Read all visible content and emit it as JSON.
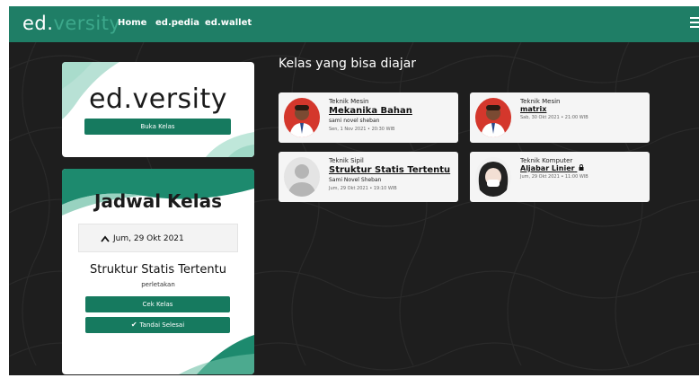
{
  "navbar": {
    "logo_part1": "ed.",
    "logo_part2": "versity",
    "links": [
      "Home",
      "ed.pedia",
      "ed.wallet"
    ],
    "menu_icon": "hamburger-icon"
  },
  "brand_card": {
    "title": "ed.versity",
    "button": "Buka Kelas"
  },
  "schedule_card": {
    "title": "Jadwal Kelas",
    "date": "Jum, 29 Okt 2021",
    "chevron_icon": "chevron-up-icon",
    "class_title": "Struktur Statis Tertentu",
    "class_sub": "perletakan",
    "check_button": "Cek Kelas",
    "done_button": "Tandai Selesai",
    "done_icon": "check-icon"
  },
  "section_title": "Kelas yang bisa diajar",
  "classes": [
    {
      "dept": "Teknik Mesin",
      "title": "Mekanika Bahan",
      "teacher": "sami novel sheban",
      "time": "Sen, 1 Nov 2021 • 20:30 WIB",
      "locked": false
    },
    {
      "dept": "Teknik Mesin",
      "title": "matrix",
      "teacher": "",
      "time": "Sab, 30 Okt 2021 • 21:00 WIB",
      "locked": false
    },
    {
      "dept": "Teknik Sipil",
      "title": "Struktur Statis Tertentu",
      "teacher": "Sami Novel Sheban",
      "time": "Jum, 29 Okt 2021 • 19:10 WIB",
      "locked": false
    },
    {
      "dept": "Teknik Komputer",
      "title": "Aljabar Linier",
      "teacher": "",
      "time": "Jum, 29 Okt 2021 • 11:00 WIB",
      "locked": true
    }
  ],
  "colors": {
    "nav": "#1f7e66",
    "accent": "#167a5f",
    "background": "#1e1e1e"
  }
}
